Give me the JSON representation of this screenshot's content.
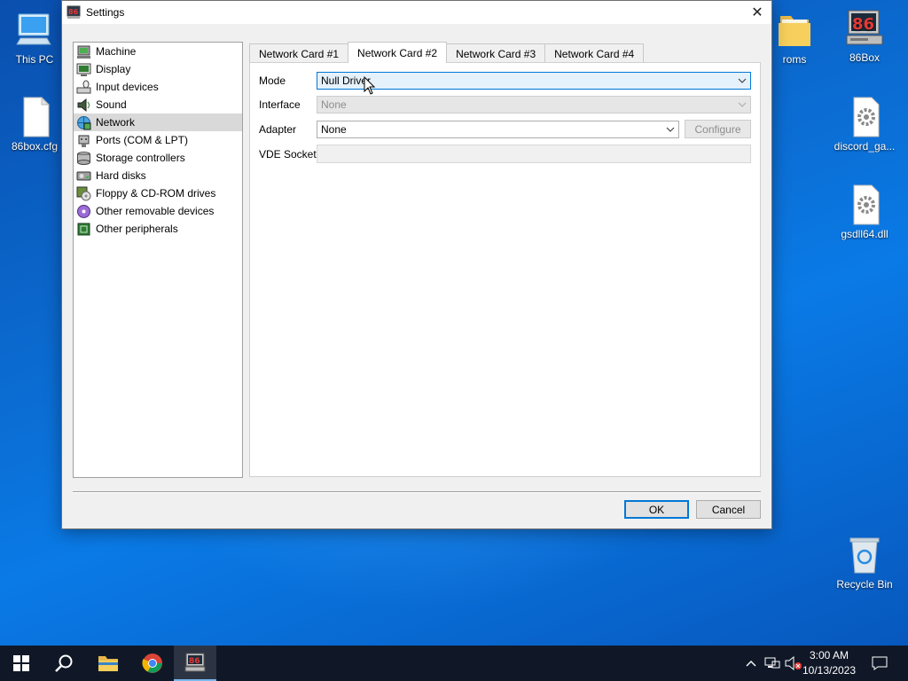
{
  "desktop": {
    "icons_left": [
      {
        "label": "This PC",
        "icon": "computer-icon"
      },
      {
        "label": "86box.cfg",
        "icon": "file-icon"
      }
    ],
    "icons_right": [
      {
        "label": "roms",
        "icon": "folder-icon"
      },
      {
        "label": "86Box",
        "icon": "86box-icon"
      },
      {
        "label": "discord_ga...",
        "icon": "dll-gear-icon"
      },
      {
        "label": "gsdll64.dll",
        "icon": "dll-gear-icon"
      },
      {
        "label": "Recycle Bin",
        "icon": "recycle-bin-icon"
      }
    ]
  },
  "window": {
    "title": "Settings",
    "close_glyph": "✕",
    "tree": [
      {
        "label": "Machine",
        "icon": "machine-icon",
        "selected": false
      },
      {
        "label": "Display",
        "icon": "display-icon",
        "selected": false
      },
      {
        "label": "Input devices",
        "icon": "input-devices-icon",
        "selected": false
      },
      {
        "label": "Sound",
        "icon": "sound-icon",
        "selected": false
      },
      {
        "label": "Network",
        "icon": "network-icon",
        "selected": true
      },
      {
        "label": "Ports (COM & LPT)",
        "icon": "ports-icon",
        "selected": false
      },
      {
        "label": "Storage controllers",
        "icon": "storage-icon",
        "selected": false
      },
      {
        "label": "Hard disks",
        "icon": "hard-disk-icon",
        "selected": false
      },
      {
        "label": "Floppy & CD-ROM drives",
        "icon": "floppy-cdrom-icon",
        "selected": false
      },
      {
        "label": "Other removable devices",
        "icon": "removable-icon",
        "selected": false
      },
      {
        "label": "Other peripherals",
        "icon": "peripherals-icon",
        "selected": false
      }
    ],
    "tabs": [
      {
        "label": "Network Card #1",
        "active": false
      },
      {
        "label": "Network Card #2",
        "active": true
      },
      {
        "label": "Network Card #3",
        "active": false
      },
      {
        "label": "Network Card #4",
        "active": false
      }
    ],
    "form": {
      "mode_label": "Mode",
      "mode_value": "Null Driver",
      "interface_label": "Interface",
      "interface_value": "None",
      "adapter_label": "Adapter",
      "adapter_value": "None",
      "configure_label": "Configure",
      "vde_label": "VDE Socket",
      "vde_value": ""
    },
    "ok_label": "OK",
    "cancel_label": "Cancel"
  },
  "taskbar": {
    "time": "3:00 AM",
    "date": "10/13/2023"
  },
  "colors": {
    "accent": "#0078d7",
    "selection": "#d9d9d9",
    "taskbar": "#101828"
  }
}
